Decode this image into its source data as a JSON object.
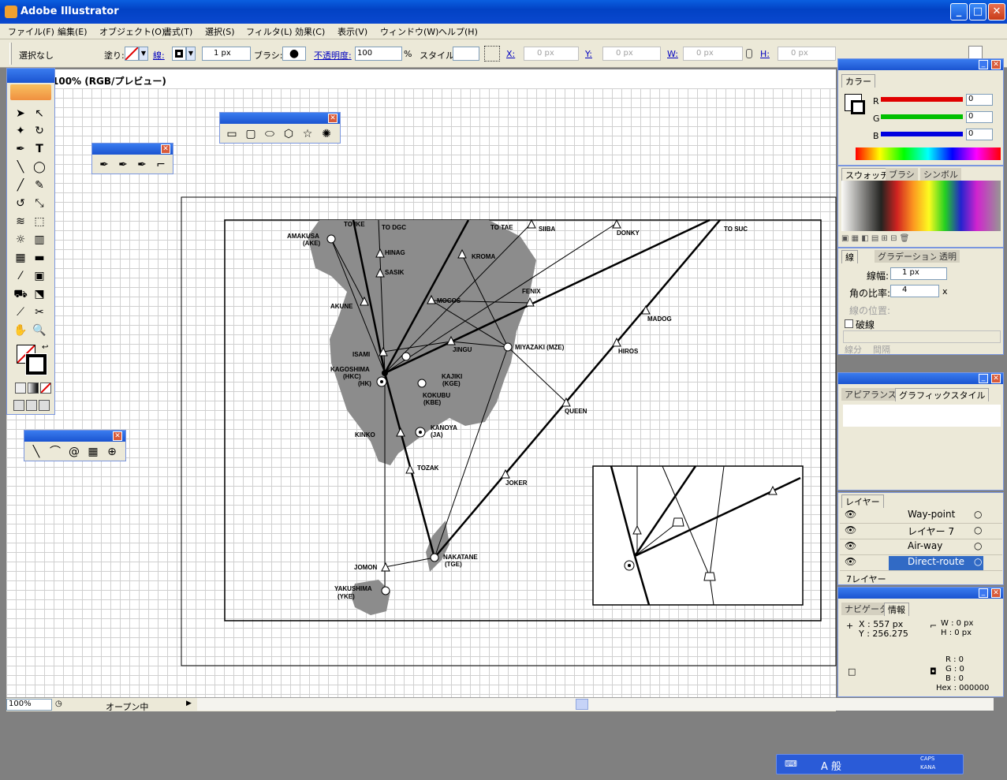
{
  "window": {
    "title": "Adobe Illustrator"
  },
  "menu": [
    "ファイル(F)",
    "編集(E)",
    "オブジェクト(O)",
    "書式(T)",
    "選択(S)",
    "フィルタ(L)",
    "効果(C)",
    "表示(V)",
    "ウィンドウ(W)",
    "ヘルプ(H)"
  ],
  "control": {
    "selection": "選択なし",
    "fill": "塗り:",
    "stroke": "線:",
    "stroke_width": "1 px",
    "brush": "ブラシ:",
    "opacity_label": "不透明度:",
    "opacity": "100",
    "percent": "%",
    "style": "スタイル:",
    "x": "X:",
    "y": "Y:",
    "w": "W:",
    "h": "H:",
    "zero": "0 px"
  },
  "document": {
    "title": "100% (RGB/プレビュー)",
    "zoom": "100%",
    "status": "オープン中"
  },
  "map": {
    "labels": [
      "TO IKE",
      "TO DGC",
      "TO TAE",
      "SIIBA",
      "DONKY",
      "TO SUC",
      "AMAKUSA",
      "(AKE)",
      "HINAG",
      "KROMA",
      "SASIK",
      "MOCOS",
      "FENIX",
      "AKUNE",
      "MADOG",
      "ISAMI",
      "JINGU",
      "MIYAZAKI (MZE)",
      "HIROS",
      "KAGOSHIMA",
      "(HKC)",
      "(HK)",
      "KAJIKI",
      "(KGE)",
      "KOKUBU",
      "(KBE)",
      "QUEEN",
      "KANOYA",
      "(JA)",
      "KINKO",
      "TOZAK",
      "JOKER",
      "NAKATANE",
      "(TGE)",
      "JOMON",
      "YAKUSHIMA",
      "(YKE)"
    ]
  },
  "color_panel": {
    "title": "カラー",
    "r_label": "R",
    "g_label": "G",
    "b_label": "B",
    "r": "0",
    "g": "0",
    "b": "0",
    "red": "#e00000",
    "green": "#00c000",
    "blue": "#0000e0"
  },
  "swatch_panel": {
    "tabs": [
      "スウォッチ",
      "ブラシ",
      "シンボル"
    ]
  },
  "stroke_panel": {
    "tabs": [
      "線",
      "グラデーション",
      "透明"
    ],
    "weight_label": "線幅:",
    "weight": "1 px",
    "miter_label": "角の比率:",
    "miter": "4",
    "miter_unit": "x",
    "align_label": "線の位置:",
    "dashed": "破線",
    "dash": "線分",
    "gap": "間隔"
  },
  "appearance_panel": {
    "tabs": [
      "アピアランス",
      "グラフィックスタイル"
    ]
  },
  "layers_panel": {
    "tab": "レイヤー",
    "layers": [
      {
        "name": "Way-point"
      },
      {
        "name": "レイヤー 7"
      },
      {
        "name": "Air-way"
      },
      {
        "name": "Direct-route"
      }
    ],
    "footer": "7レイヤー"
  },
  "info_panel": {
    "tabs": [
      "ナビゲータ",
      "情報"
    ],
    "x": "X : 557 px",
    "y": "Y : 256.275",
    "w": "W : 0 px",
    "h": "H : 0 px",
    "r": "R : 0",
    "g": "G : 0",
    "b": "B : 0",
    "hex": "Hex : 000000"
  },
  "taskbar": {
    "ime": "A 般",
    "caps": "CAPS",
    "kana": "KANA"
  }
}
